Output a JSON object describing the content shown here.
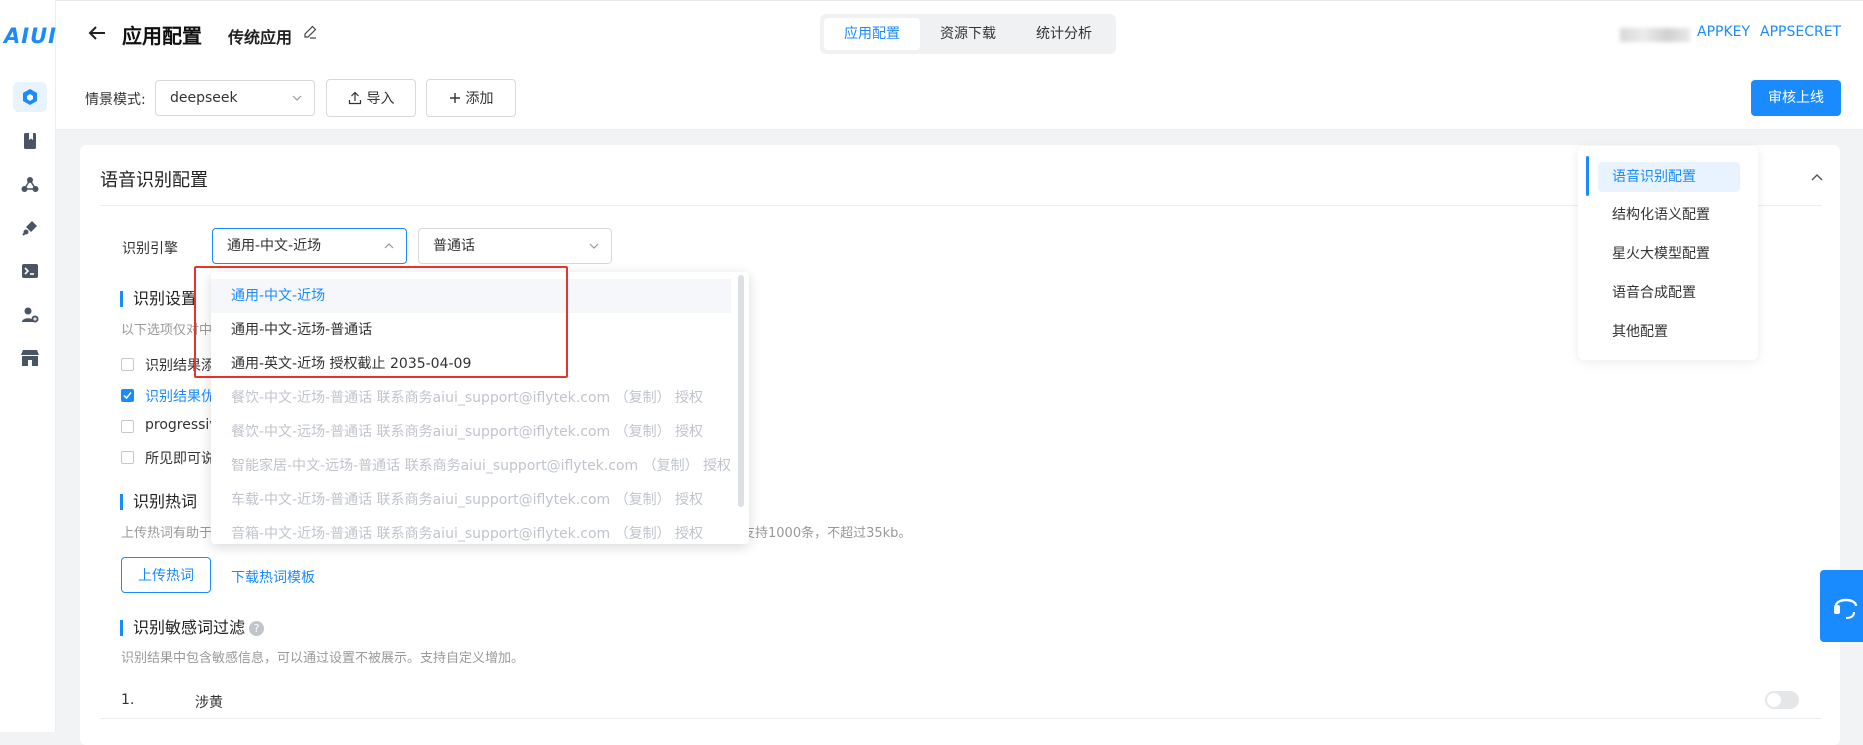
{
  "app": {
    "logo": "AIUI"
  },
  "sidebar": {
    "icons": [
      "cube-icon",
      "bookmark-icon",
      "nodes-icon",
      "plug-icon",
      "terminal-icon",
      "user-add-icon",
      "store-icon"
    ]
  },
  "header": {
    "title": "应用配置",
    "subtitle": "传统应用",
    "tabs": [
      {
        "label": "应用配置",
        "active": true
      },
      {
        "label": "资源下载",
        "active": false
      },
      {
        "label": "统计分析",
        "active": false
      }
    ],
    "appkey_label": "APPKEY",
    "appsecret_label": "APPSECRET"
  },
  "toolbar": {
    "scene_label": "情景模式:",
    "scene_value": "deepseek",
    "import_label": "导入",
    "add_label": "添加",
    "submit_label": "审核上线"
  },
  "card": {
    "title": "语音识别配置",
    "engine_label": "识别引擎",
    "engine_value": "通用-中文-近场",
    "dialect_value": "普通话",
    "settings_heading": "识别设置",
    "settings_desc": "以下选项仅对中",
    "options": [
      {
        "label": "识别结果添",
        "checked": false
      },
      {
        "label": "识别结果优",
        "checked": true
      },
      {
        "label": "progressiv",
        "checked": false
      },
      {
        "label": "所见即可说",
        "checked": false
      }
    ],
    "hotword_heading": "识别热词",
    "hotword_desc_left": "上传热词有助于",
    "hotword_desc_right": "支持1000条，不超过35kb。",
    "upload_hotword": "上传热词",
    "download_template": "下载热词模板",
    "sensitive_heading": "识别敏感词过滤",
    "sensitive_desc": "识别结果中包含敏感信息，可以通过设置不被展示。支持自定义增加。",
    "sensitive_rows": [
      {
        "index": "1.",
        "label": "涉黄"
      }
    ]
  },
  "dropdown": {
    "items": [
      {
        "label": "通用-中文-近场",
        "state": "selected"
      },
      {
        "label": "通用-中文-远场-普通话",
        "state": "normal"
      },
      {
        "label": "通用-英文-近场 授权截止 2035-04-09",
        "state": "normal"
      },
      {
        "label": "餐饮-中文-近场-普通话 联系商务aiui_support@iflytek.com （复制） 授权",
        "state": "disabled"
      },
      {
        "label": "餐饮-中文-远场-普通话 联系商务aiui_support@iflytek.com （复制） 授权",
        "state": "disabled"
      },
      {
        "label": "智能家居-中文-远场-普通话 联系商务aiui_support@iflytek.com （复制） 授权",
        "state": "disabled"
      },
      {
        "label": "车载-中文-近场-普通话 联系商务aiui_support@iflytek.com （复制） 授权",
        "state": "disabled"
      },
      {
        "label": "音箱-中文-近场-普通话 联系商务aiui_support@iflytek.com （复制） 授权",
        "state": "disabled"
      }
    ]
  },
  "anchor_nav": {
    "items": [
      {
        "label": "语音识别配置",
        "active": true
      },
      {
        "label": "结构化语义配置",
        "active": false
      },
      {
        "label": "星火大模型配置",
        "active": false
      },
      {
        "label": "语音合成配置",
        "active": false
      },
      {
        "label": "其他配置",
        "active": false
      }
    ]
  },
  "colors": {
    "accent": "#1a8bff",
    "highlight_box": "#e5352b",
    "disabled_text": "#c0c4cc"
  }
}
